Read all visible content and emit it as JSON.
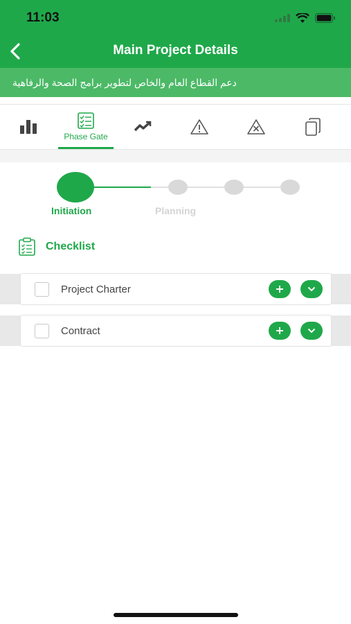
{
  "status_bar": {
    "time": "11:03"
  },
  "header": {
    "title": "Main Project Details"
  },
  "project_name": "دعم القطاع العام والخاص لتطوير برامج الصحة والرفاهية",
  "tabs": [
    {
      "icon": "bar-chart-icon",
      "label": ""
    },
    {
      "icon": "checklist-icon",
      "label": "Phase Gate",
      "active": true
    },
    {
      "icon": "trend-icon",
      "label": ""
    },
    {
      "icon": "warning-icon",
      "label": ""
    },
    {
      "icon": "issue-icon",
      "label": ""
    },
    {
      "icon": "copy-icon",
      "label": ""
    }
  ],
  "stepper": {
    "steps": [
      {
        "label": "Initiation",
        "state": "active"
      },
      {
        "label": "Planning",
        "state": "inactive"
      },
      {
        "label": "",
        "state": "inactive"
      },
      {
        "label": "",
        "state": "inactive"
      }
    ]
  },
  "checklist": {
    "title": "Checklist",
    "items": [
      {
        "label": "Project Charter",
        "checked": false
      },
      {
        "label": "Contract",
        "checked": false
      }
    ]
  },
  "colors": {
    "primary": "#1fa84a",
    "subbar": "#4cb967",
    "inactive": "#d9d9d9"
  }
}
